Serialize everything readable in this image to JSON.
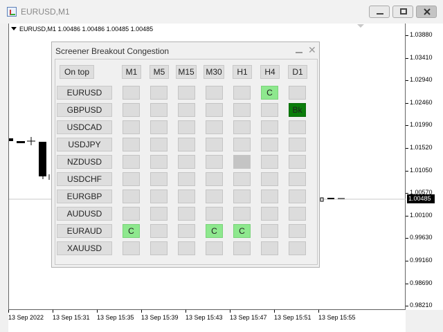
{
  "window": {
    "title": "EURUSD,M1"
  },
  "chart": {
    "header": "EURUSD,M1  1.00486 1.00486 1.00485 1.00485",
    "price_labels": [
      "1.03880",
      "1.03410",
      "1.02940",
      "1.02460",
      "1.01990",
      "1.01520",
      "1.01050",
      "1.00570",
      "1.00100",
      "0.99630",
      "0.99160",
      "0.98690",
      "0.98210"
    ],
    "current_price": "1.00485",
    "time_labels": [
      "13 Sep 2022",
      "13 Sep 15:31",
      "13 Sep 15:35",
      "13 Sep 15:39",
      "13 Sep 15:43",
      "13 Sep 15:47",
      "13 Sep 15:51",
      "13 Sep 15:55"
    ]
  },
  "panel": {
    "title": "Screener Breakout Congestion",
    "on_top_label": "On top",
    "timeframes": [
      "M1",
      "M5",
      "M15",
      "M30",
      "H1",
      "H4",
      "D1"
    ],
    "rows": [
      {
        "symbol": "EURUSD",
        "cells": [
          "",
          "",
          "",
          "",
          "",
          "C",
          ""
        ]
      },
      {
        "symbol": "GBPUSD",
        "cells": [
          "",
          "",
          "",
          "",
          "",
          "",
          "Bk"
        ]
      },
      {
        "symbol": "USDCAD",
        "cells": [
          "",
          "",
          "",
          "",
          "",
          "",
          ""
        ]
      },
      {
        "symbol": "USDJPY",
        "cells": [
          "",
          "",
          "",
          "",
          "",
          "",
          ""
        ]
      },
      {
        "symbol": "NZDUSD",
        "cells": [
          "",
          "",
          "",
          "",
          "gray",
          "",
          ""
        ]
      },
      {
        "symbol": "USDCHF",
        "cells": [
          "",
          "",
          "",
          "",
          "",
          "",
          ""
        ]
      },
      {
        "symbol": "EURGBP",
        "cells": [
          "",
          "",
          "",
          "",
          "",
          "",
          ""
        ]
      },
      {
        "symbol": "AUDUSD",
        "cells": [
          "",
          "",
          "",
          "",
          "",
          "",
          ""
        ]
      },
      {
        "symbol": "EURAUD",
        "cells": [
          "C",
          "",
          "",
          "C",
          "C",
          "",
          ""
        ]
      },
      {
        "symbol": "XAUUSD",
        "cells": [
          "",
          "",
          "",
          "",
          "",
          "",
          ""
        ]
      }
    ]
  },
  "colors": {
    "congestion": "#8ee88e",
    "breakout": "#0b7d0b",
    "empty": "#dcdcdc"
  }
}
